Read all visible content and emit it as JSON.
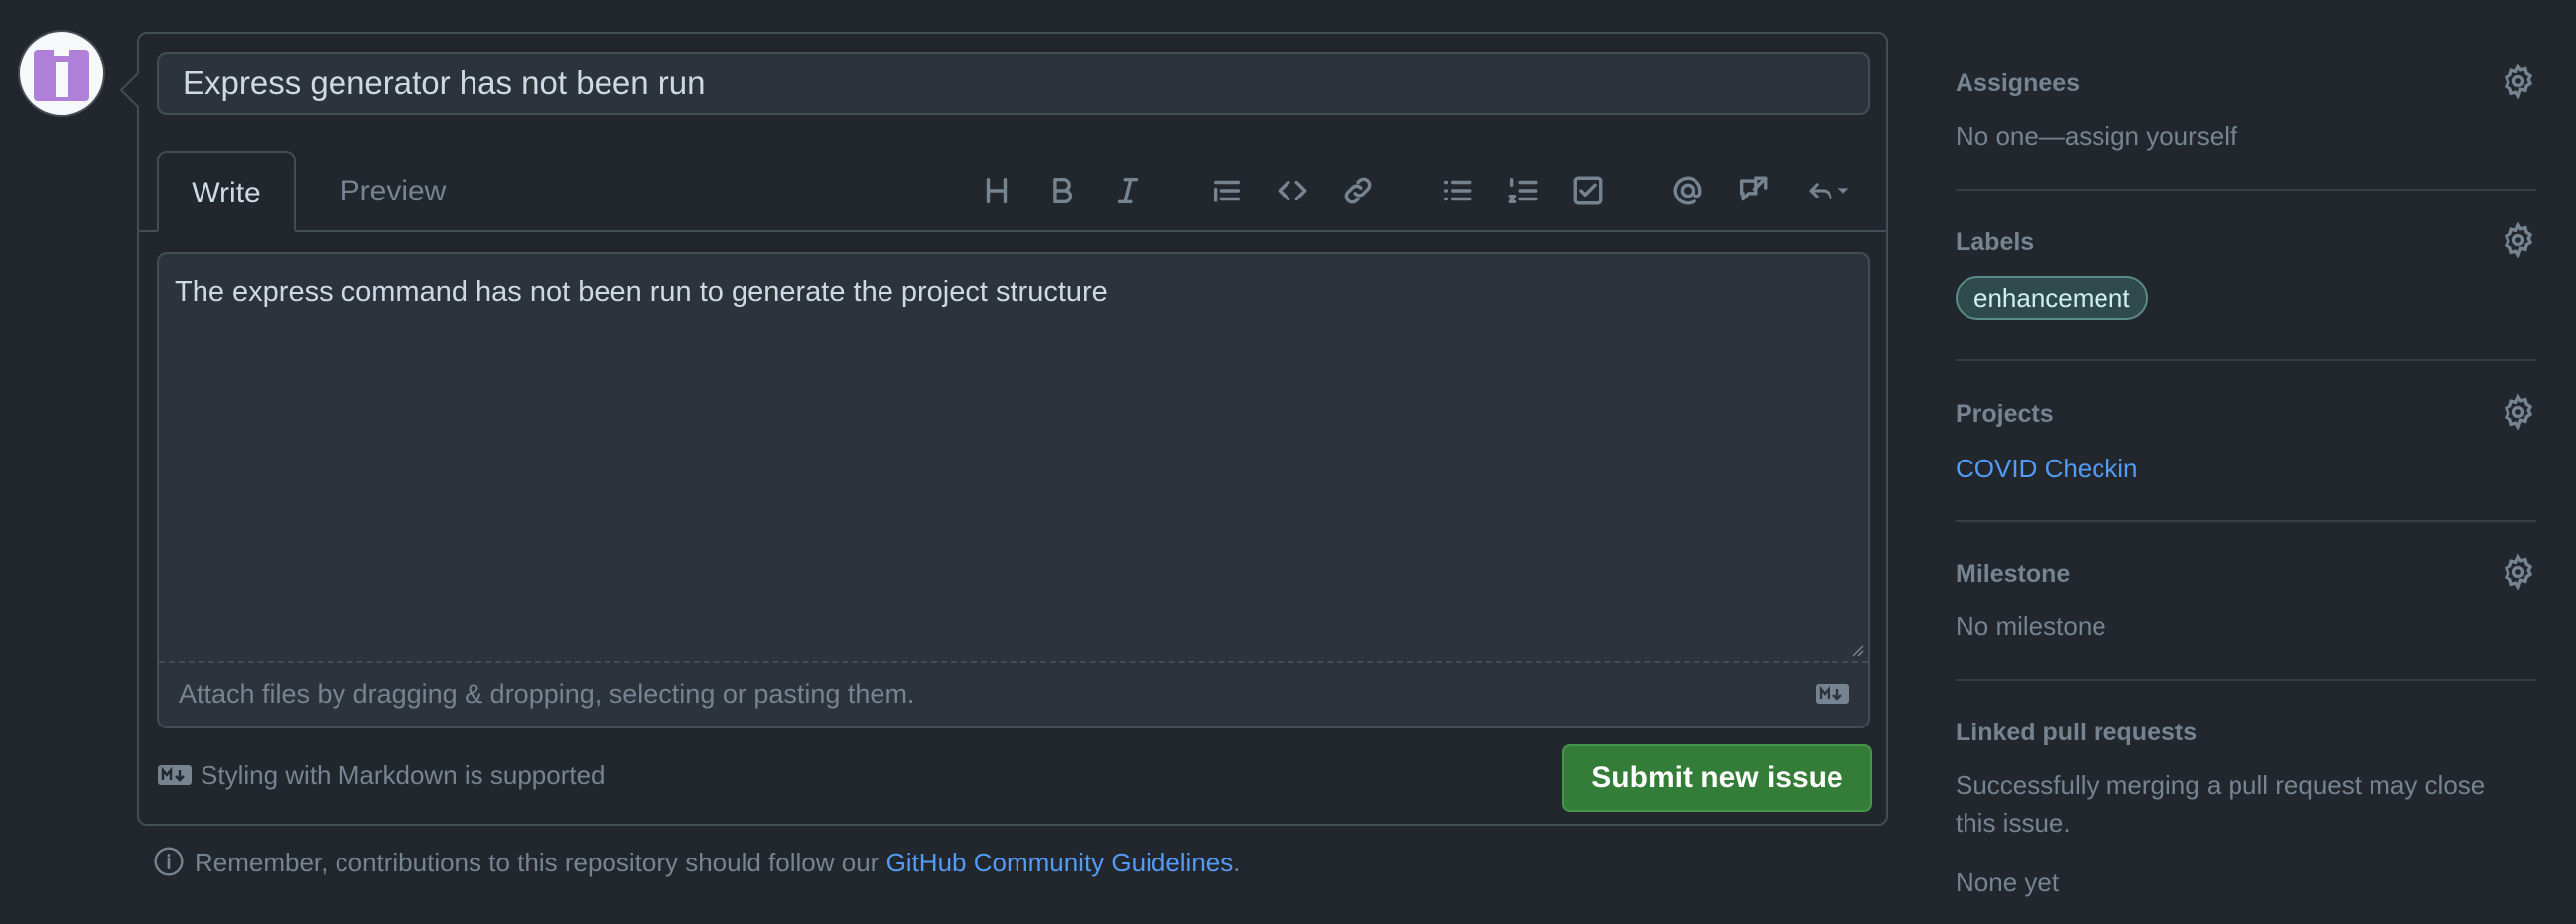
{
  "issue": {
    "title_value": "Express generator has not been run",
    "body_text": "The express command has not been run to generate the project structure"
  },
  "tabs": [
    {
      "label": "Write"
    },
    {
      "label": "Preview"
    }
  ],
  "toolbar_icons": [
    "heading-icon",
    "bold-icon",
    "italic-icon",
    "quote-icon",
    "code-icon",
    "link-icon",
    "bulleted-list-icon",
    "numbered-list-icon",
    "task-list-icon",
    "mention-icon",
    "reference-icon",
    "reply-icon"
  ],
  "editor": {
    "attach_text": "Attach files by dragging & dropping, selecting or pasting them."
  },
  "footer": {
    "markdown_hint": "Styling with Markdown is supported",
    "submit_label": "Submit new issue",
    "guidelines_prefix": "Remember, contributions to this repository should follow our ",
    "guidelines_link": "GitHub Community Guidelines",
    "guidelines_suffix": "."
  },
  "sidebar": {
    "assignees": {
      "title": "Assignees",
      "value": "No one—assign yourself"
    },
    "labels": {
      "title": "Labels",
      "label": "enhancement"
    },
    "projects": {
      "title": "Projects",
      "link": "COVID Checkin"
    },
    "milestone": {
      "title": "Milestone",
      "value": "No milestone"
    },
    "linked_prs": {
      "title": "Linked pull requests",
      "description": "Successfully merging a pull request may close this issue.",
      "value": "None yet"
    }
  },
  "colors": {
    "background": "#22272e",
    "submit_green": "#347d39",
    "link_blue": "#539bf5",
    "label_teal": "#2e4a4a"
  }
}
